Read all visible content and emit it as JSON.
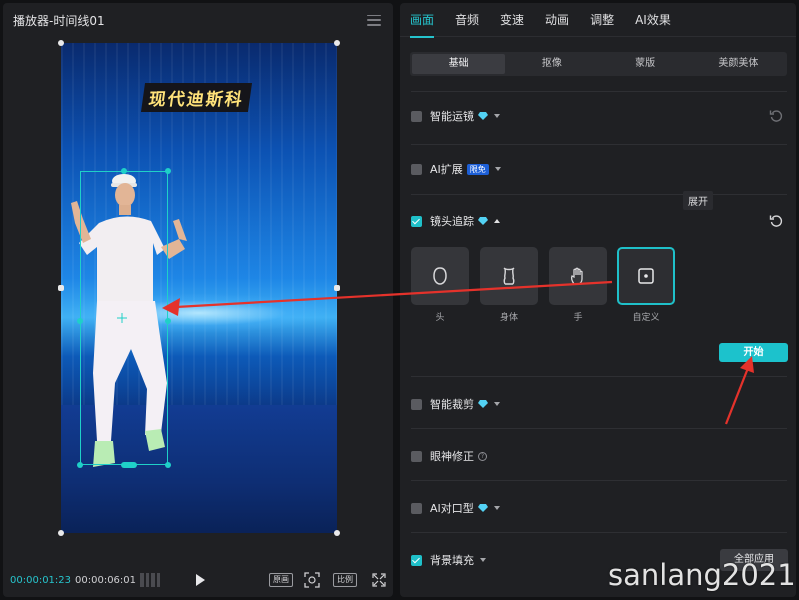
{
  "player": {
    "title": "播放器-时间线01",
    "caption": "现代迪斯科",
    "time_current": "00:00:01:23",
    "time_total": "00:00:06:01",
    "original_label": "原画",
    "ratio_label": "比例"
  },
  "panel": {
    "tabs": [
      {
        "label": "画面",
        "active": true
      },
      {
        "label": "音频"
      },
      {
        "label": "变速"
      },
      {
        "label": "动画"
      },
      {
        "label": "调整"
      },
      {
        "label": "AI效果"
      }
    ],
    "subtabs": [
      {
        "label": "基础",
        "active": true
      },
      {
        "label": "抠像"
      },
      {
        "label": "蒙版"
      },
      {
        "label": "美颜美体"
      }
    ],
    "features": {
      "smart_camera": {
        "label": "智能运镜",
        "checked": false
      },
      "ai_expand": {
        "label": "AI扩展",
        "badge": "限免",
        "checked": false
      },
      "camera_tracking": {
        "label": "镜头追踪",
        "checked": true
      },
      "smart_crop": {
        "label": "智能裁剪",
        "checked": false
      },
      "eye_correct": {
        "label": "眼神修正",
        "checked": false
      },
      "ai_lipsync": {
        "label": "AI对口型",
        "checked": false
      },
      "bg_fill": {
        "label": "背景填充",
        "checked": true
      }
    },
    "tooltip": "展开",
    "targets": [
      {
        "label": "头",
        "icon": "head-icon"
      },
      {
        "label": "身体",
        "icon": "body-icon"
      },
      {
        "label": "手",
        "icon": "hand-icon"
      },
      {
        "label": "自定义",
        "icon": "custom-icon",
        "selected": true
      }
    ],
    "start_label": "开始",
    "apply_all_label": "全部应用"
  },
  "watermark": "sanlang2021",
  "colors": {
    "accent": "#1fc0c9",
    "annotation_arrow": "#e5322b",
    "panel_bg": "#1f2023"
  }
}
